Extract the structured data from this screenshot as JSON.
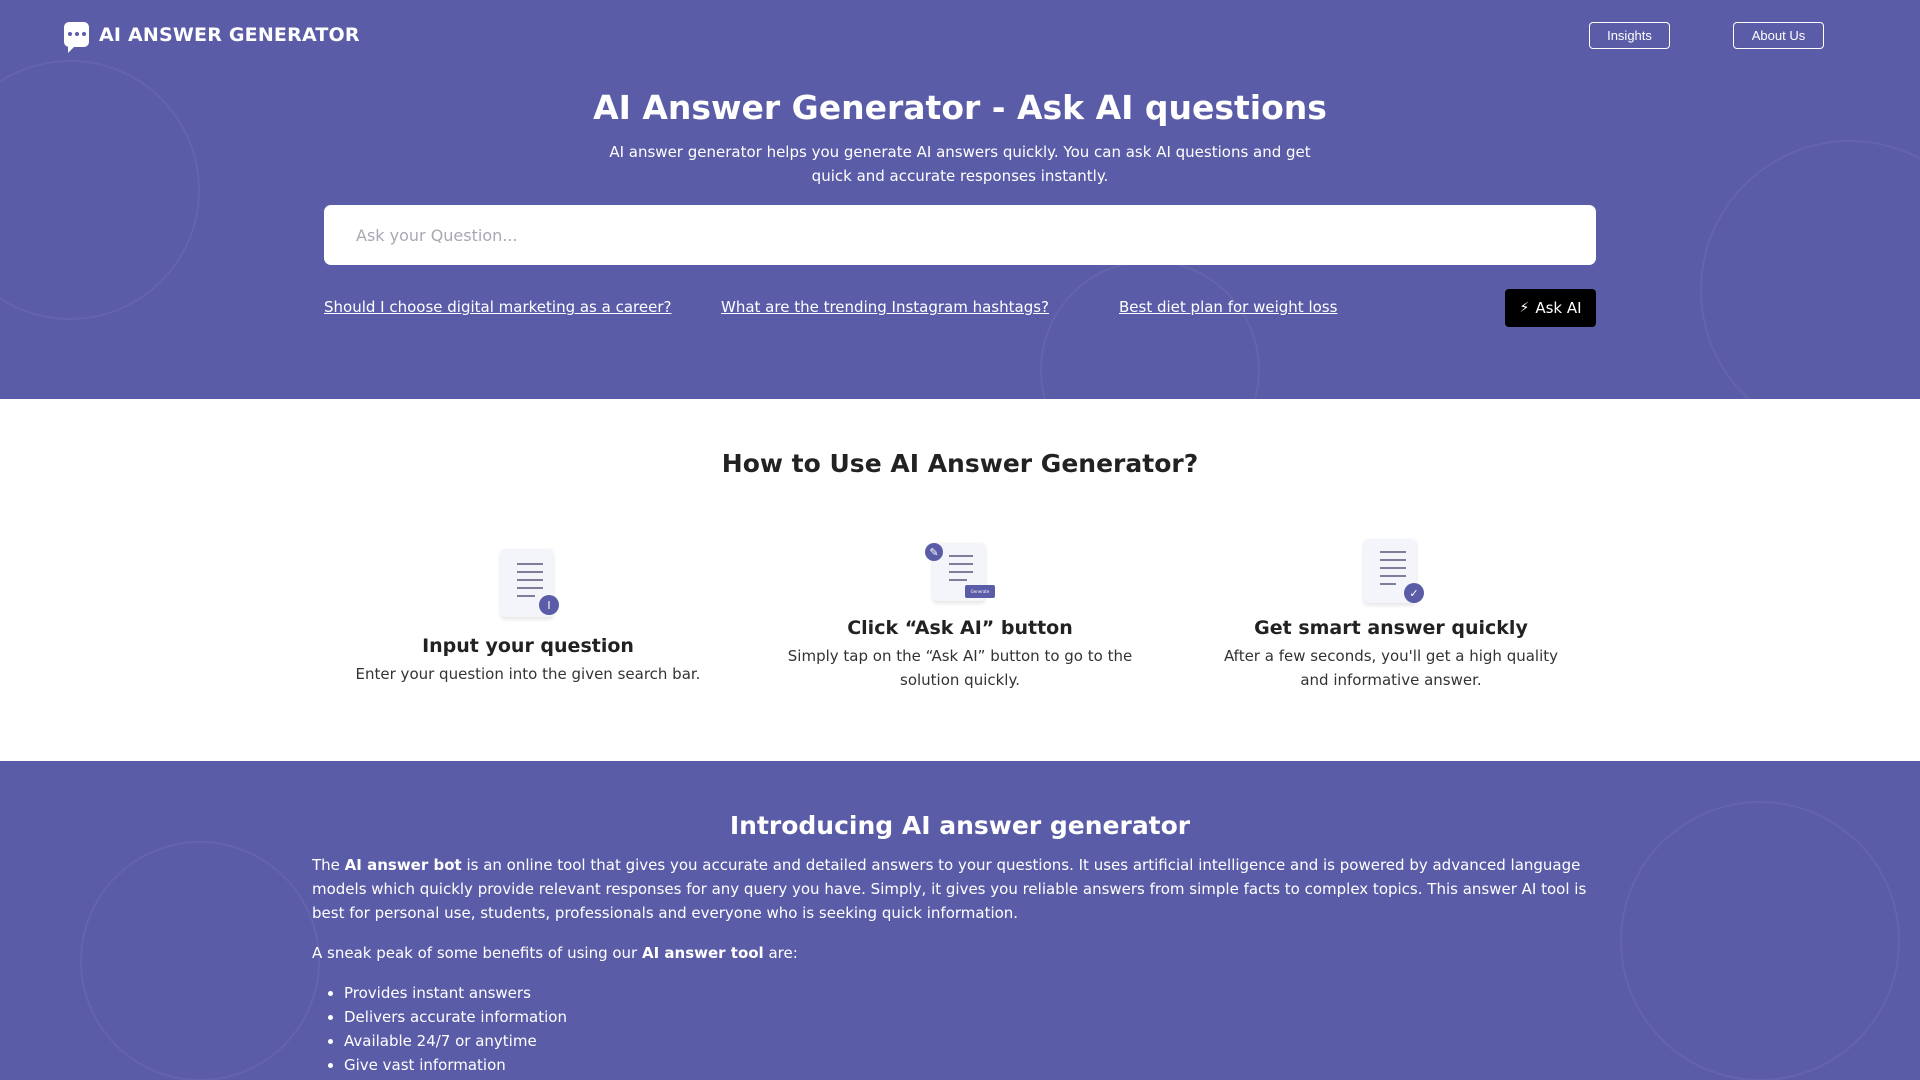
{
  "brand": {
    "name": "AI ANSWER GENERATOR",
    "icon": "chat-bubble-icon"
  },
  "nav": {
    "insights": "Insights",
    "about": "About Us"
  },
  "hero": {
    "title": "AI Answer Generator - Ask AI questions",
    "subtitle": "AI answer generator helps you generate AI answers quickly. You can ask AI questions and get quick and accurate responses instantly.",
    "search_placeholder": "Ask your Question...",
    "suggestions": [
      "Should I choose digital marketing as a career?",
      "What are the trending Instagram hashtags?",
      "Best diet plan for weight loss"
    ],
    "ask_button": "Ask AI",
    "ask_icon": "magic-wand-icon"
  },
  "how": {
    "title": "How to Use AI Answer Generator?",
    "steps": [
      {
        "title": "Input your question",
        "desc": "Enter your question into the given search bar.",
        "icon": "document-cursor-icon"
      },
      {
        "title": "Click “Ask AI” button",
        "desc": "Simply tap on the “Ask AI” button to go to the solution quickly.",
        "icon": "document-generate-icon",
        "mini_label": "Generate"
      },
      {
        "title": "Get smart answer quickly",
        "desc": "After a few seconds, you'll get a high quality and informative answer.",
        "icon": "document-check-icon"
      }
    ]
  },
  "intro": {
    "title": "Introducing AI answer generator",
    "p1_pre": "The ",
    "p1_bold": "AI answer bot",
    "p1_post": " is an online tool that gives you accurate and detailed answers to your questions. It uses artificial intelligence and is powered by advanced language models which quickly provide relevant responses for any query you have. Simply, it gives you reliable answers from simple facts to complex topics. This answer AI tool is best for personal use, students, professionals and everyone who is seeking quick information.",
    "p2_pre": "A sneak peak of some benefits of using our ",
    "p2_bold": "AI answer tool",
    "p2_post": " are:",
    "benefits": [
      "Provides instant answers",
      "Delivers accurate information",
      "Available 24/7 or anytime",
      "Give vast information"
    ]
  },
  "colors": {
    "primary": "#5b5ca8",
    "button_dark": "#000000",
    "white": "#ffffff"
  }
}
